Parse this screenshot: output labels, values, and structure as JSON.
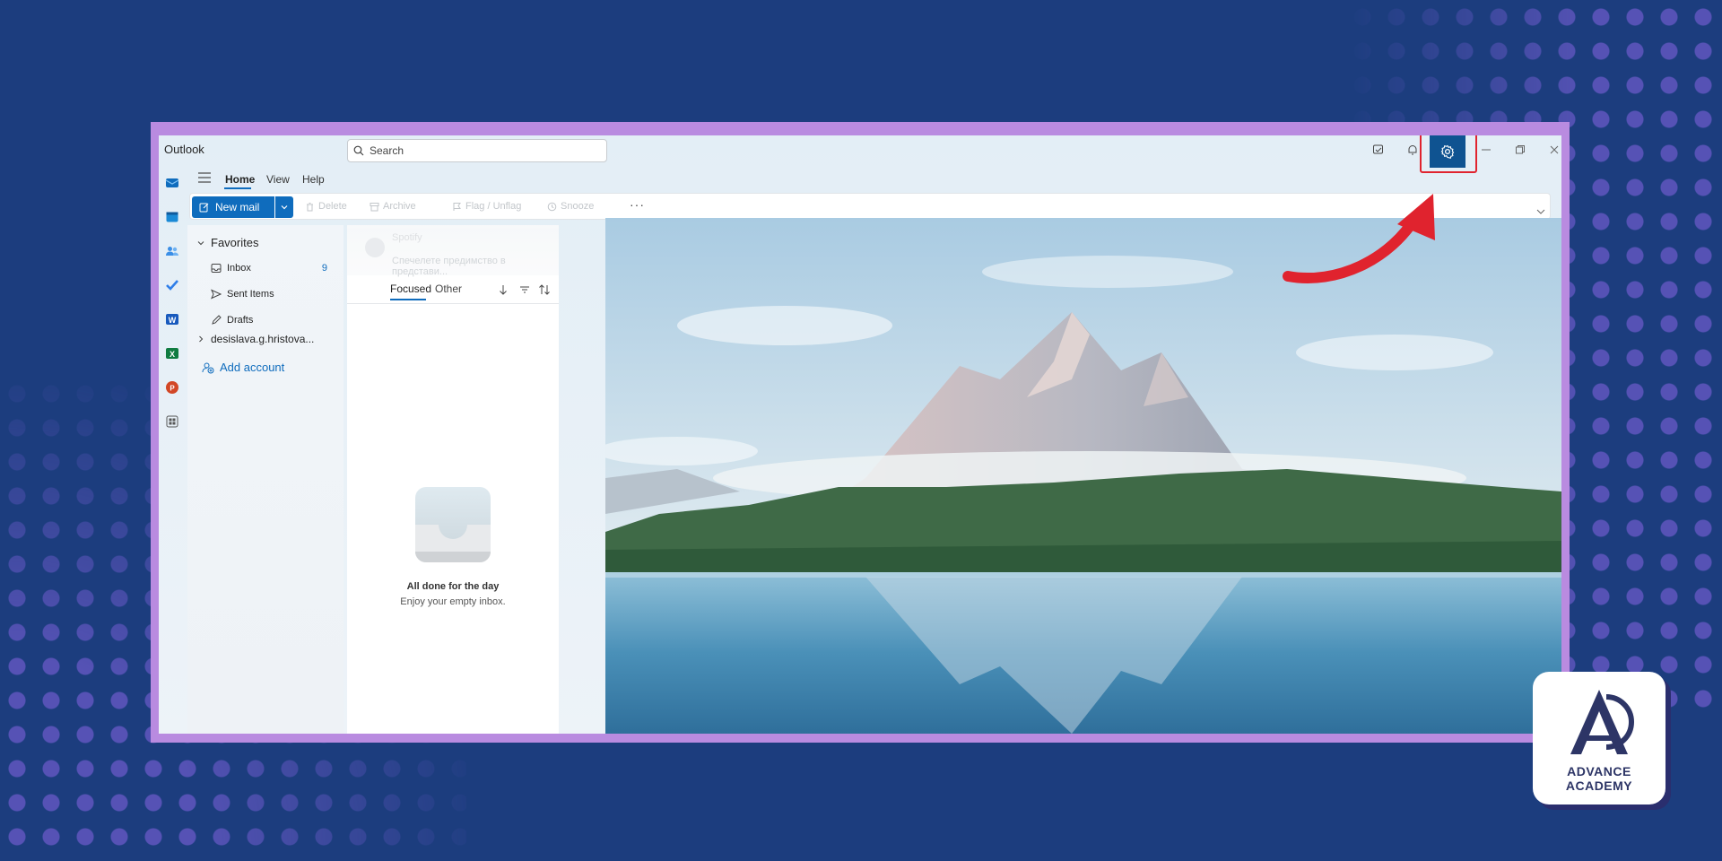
{
  "app": {
    "title": "Outlook"
  },
  "search": {
    "placeholder": "Search"
  },
  "menu": {
    "tabs": [
      {
        "label": "Home",
        "active": true
      },
      {
        "label": "View",
        "active": false
      },
      {
        "label": "Help",
        "active": false
      }
    ]
  },
  "toolbar": {
    "new_mail_label": "New mail",
    "delete_label": "Delete",
    "archive_label": "Archive",
    "flag_label": "Flag / Unflag",
    "snooze_label": "Snooze",
    "more_label": "···"
  },
  "folders": {
    "favorites_label": "Favorites",
    "items": [
      {
        "label": "Inbox",
        "count": "9",
        "icon": "inbox-icon"
      },
      {
        "label": "Sent Items",
        "count": "",
        "icon": "send-icon"
      },
      {
        "label": "Drafts",
        "count": "",
        "icon": "pencil-icon"
      }
    ],
    "account_label": "desislava.g.hristova...",
    "add_account_label": "Add account"
  },
  "message_list": {
    "ghost_title": "Spotify",
    "ghost_preview": "Спечелете предимство в представи...",
    "tabs": [
      {
        "label": "Focused",
        "active": true
      },
      {
        "label": "Other",
        "active": false
      }
    ],
    "empty_title": "All done for the day",
    "empty_subtitle": "Enjoy your empty inbox."
  },
  "logo": {
    "line1": "ADVANCE",
    "line2": "ACADEMY"
  },
  "colors": {
    "background": "#1c3d7e",
    "frame": "#b98be0",
    "accent": "#0f6cbd",
    "settings_active": "#0f5391",
    "highlight": "#e0232e"
  }
}
